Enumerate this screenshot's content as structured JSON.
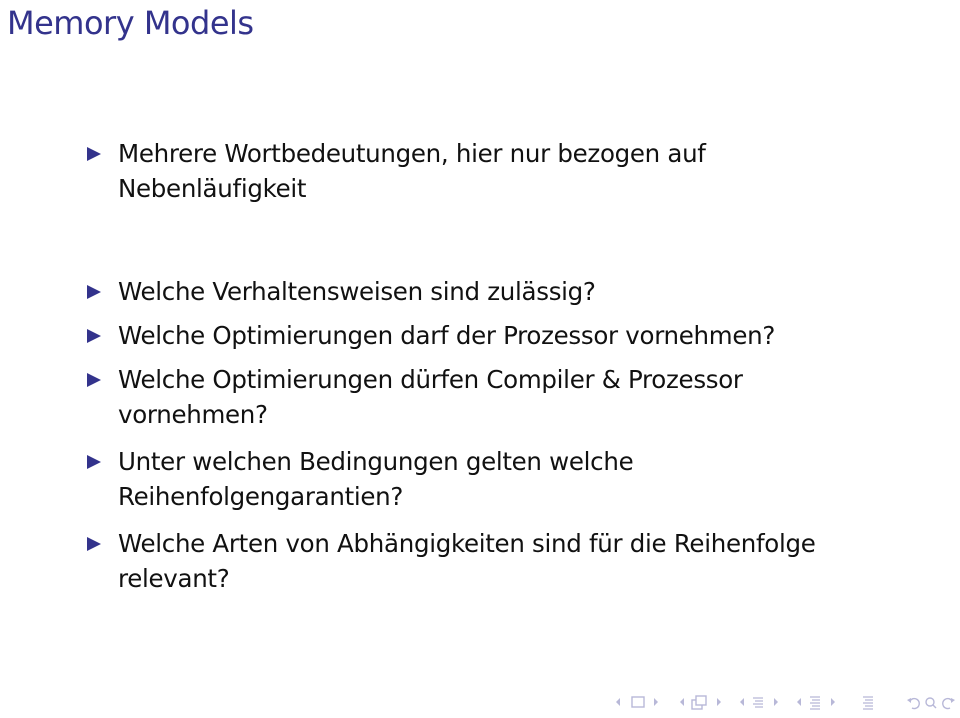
{
  "slide": {
    "title": "Memory Models",
    "items": [
      {
        "lines": [
          "Mehrere Wortbedeutungen, hier nur bezogen auf",
          "Nebenläufigkeit"
        ]
      },
      {
        "lines": [
          "Welche Verhaltensweisen sind zulässig?"
        ]
      },
      {
        "lines": [
          "Welche Optimierungen darf der Prozessor vornehmen?"
        ]
      },
      {
        "lines": [
          "Welche Optimierungen dürfen Compiler & Prozessor",
          "vornehmen?"
        ]
      },
      {
        "lines": [
          "Unter welchen Bedingungen gelten welche",
          "Reihenfolgengarantien?"
        ]
      },
      {
        "lines": [
          "Welche Arten von Abhängigkeiten sind für die Reihenfolge",
          "relevant?"
        ]
      }
    ],
    "accent_color": "#33338c"
  },
  "navigation": {
    "icons": [
      "arrow-left-icon",
      "frame-icon",
      "arrow-right-icon",
      "arrow-left-icon",
      "subsection-icon",
      "arrow-right-icon",
      "arrow-left-icon",
      "section-icon",
      "arrow-right-icon",
      "arrow-left-icon",
      "subsection-list-icon",
      "arrow-right-icon",
      "document-icon",
      "undo-icon",
      "search-icon",
      "redo-icon"
    ],
    "color": "#b8b8d8"
  }
}
